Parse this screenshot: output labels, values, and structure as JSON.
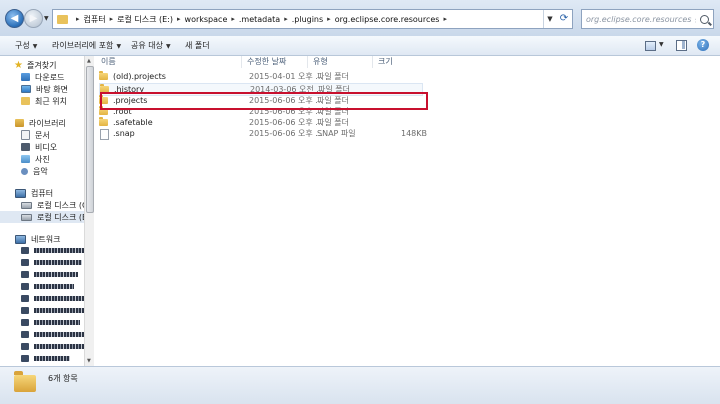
{
  "address": {
    "crumbs": [
      "컴퓨터",
      "로컬 디스크 (E:)",
      "workspace",
      ".metadata",
      ".plugins",
      "org.eclipse.core.resources"
    ]
  },
  "search": {
    "placeholder": "org.eclipse.core.resources 검색"
  },
  "toolbar": {
    "organize": "구성",
    "include_library": "라이브러리에 포함",
    "share": "공유 대상",
    "new_folder": "새 폴더"
  },
  "nav": {
    "favorites": {
      "label": "즐겨찾기",
      "items": [
        "다운로드",
        "바탕 화면",
        "최근 위치"
      ]
    },
    "libraries": {
      "label": "라이브러리",
      "items": [
        "문서",
        "비디오",
        "사진",
        "음악"
      ]
    },
    "computer": {
      "label": "컴퓨터",
      "items": [
        "로컬 디스크 (C:)",
        "로컬 디스크 (E:)"
      ]
    },
    "network": {
      "label": "네트워크"
    }
  },
  "columns": {
    "name": "이름",
    "date": "수정한 날짜",
    "type": "유형",
    "size": "크기"
  },
  "files": [
    {
      "name": "(old).projects",
      "date": "2015-04-01 오후 ...",
      "type": "파일 폴더",
      "size": "",
      "kind": "folder"
    },
    {
      "name": ".history",
      "date": "2014-03-06 오전 ...",
      "type": "파일 폴더",
      "size": "",
      "kind": "folder"
    },
    {
      "name": ".projects",
      "date": "2015-06-06 오후 ...",
      "type": "파일 폴더",
      "size": "",
      "kind": "folder"
    },
    {
      "name": ".root",
      "date": "2015-06-06 오후 ...",
      "type": "파일 폴더",
      "size": "",
      "kind": "folder"
    },
    {
      "name": ".safetable",
      "date": "2015-06-06 오후 ...",
      "type": "파일 폴더",
      "size": "",
      "kind": "folder"
    },
    {
      "name": ".snap",
      "date": "2015-06-06 오후 ...",
      "type": "SNAP 파일",
      "size": "148KB",
      "kind": "file"
    }
  ],
  "status": {
    "count": "6개 항목"
  },
  "colors": {
    "highlight": "#c8102e",
    "chrome": "#dfe9f5"
  }
}
